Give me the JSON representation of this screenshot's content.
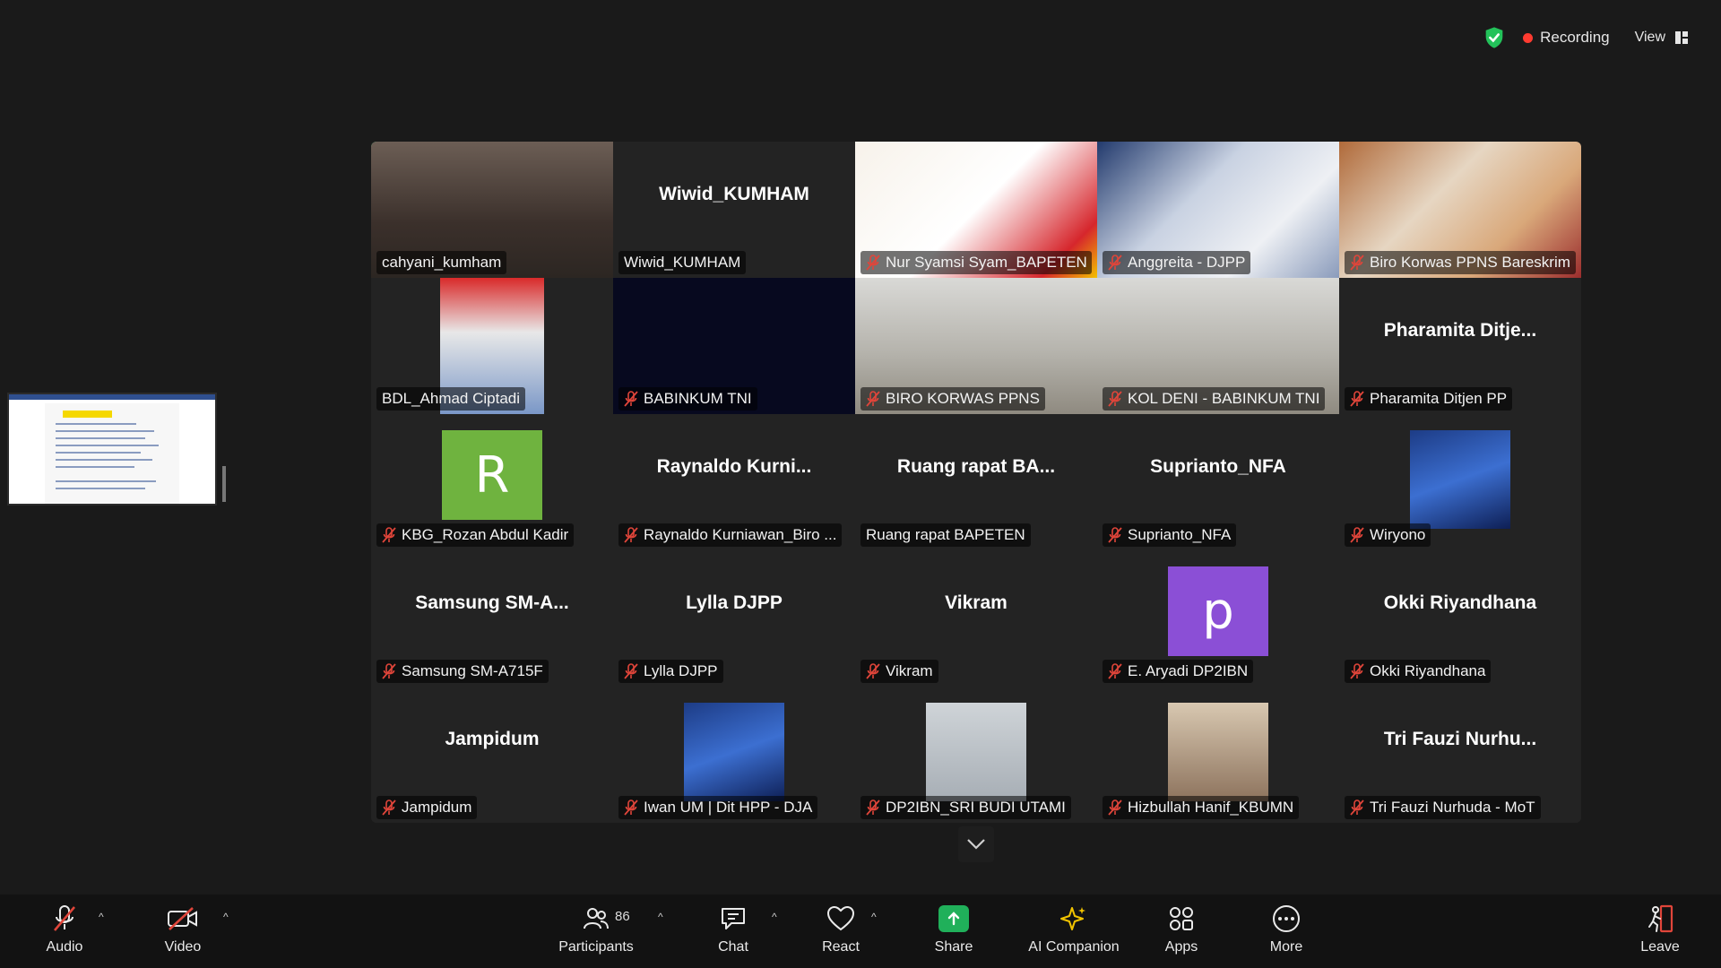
{
  "status": {
    "recording_label": "Recording",
    "view_label": "View"
  },
  "tiles": [
    {
      "name": "cahyani_kumham",
      "center": "",
      "muted": false,
      "kind": "video-face",
      "active": true
    },
    {
      "name": "Wiwid_KUMHAM",
      "center": "Wiwid_KUMHAM",
      "muted": false,
      "kind": "name-only"
    },
    {
      "name": "Nur Syamsi Syam_BAPETEN",
      "center": "",
      "muted": true,
      "kind": "video-banner1"
    },
    {
      "name": "Anggreita - DJPP",
      "center": "",
      "muted": true,
      "kind": "video-banner2"
    },
    {
      "name": "Biro Korwas PPNS Bareskrim",
      "center": "",
      "muted": true,
      "kind": "video-banner3"
    },
    {
      "name": "BDL_Ahmad Ciptadi",
      "center": "",
      "muted": false,
      "kind": "video-small-red"
    },
    {
      "name": "BABINKUM TNI",
      "center": "",
      "muted": true,
      "kind": "video-navy"
    },
    {
      "name": "BIRO KORWAS PPNS",
      "center": "",
      "muted": true,
      "kind": "video-office"
    },
    {
      "name": "KOL DENI - BABINKUM TNI",
      "center": "",
      "muted": true,
      "kind": "video-office"
    },
    {
      "name": "Pharamita Ditjen PP",
      "center": "Pharamita Ditje...",
      "muted": true,
      "kind": "name-only"
    },
    {
      "name": "KBG_Rozan Abdul Kadir",
      "center": "",
      "muted": true,
      "kind": "avatar-green",
      "avatar": "R"
    },
    {
      "name": "Raynaldo Kurniawan_Biro ...",
      "center": "Raynaldo Kurni...",
      "muted": true,
      "kind": "name-only"
    },
    {
      "name": "Ruang rapat BAPETEN",
      "center": "Ruang rapat BA...",
      "muted": false,
      "kind": "name-only"
    },
    {
      "name": "Suprianto_NFA",
      "center": "Suprianto_NFA",
      "muted": true,
      "kind": "name-only"
    },
    {
      "name": "Wiryono",
      "center": "",
      "muted": true,
      "kind": "photo-blue"
    },
    {
      "name": "Samsung SM-A715F",
      "center": "Samsung SM-A...",
      "muted": true,
      "kind": "name-only"
    },
    {
      "name": "Lylla DJPP",
      "center": "Lylla DJPP",
      "muted": true,
      "kind": "name-only"
    },
    {
      "name": "Vikram",
      "center": "Vikram",
      "muted": true,
      "kind": "name-only"
    },
    {
      "name": "E. Aryadi DP2IBN",
      "center": "",
      "muted": true,
      "kind": "avatar-purple",
      "avatar": "p"
    },
    {
      "name": "Okki Riyandhana",
      "center": "Okki Riyandhana",
      "muted": true,
      "kind": "name-only"
    },
    {
      "name": "Jampidum",
      "center": "Jampidum",
      "muted": true,
      "kind": "name-only"
    },
    {
      "name": "Iwan UM | Dit HPP - DJA",
      "center": "",
      "muted": true,
      "kind": "photo-blue"
    },
    {
      "name": "DP2IBN_SRI BUDI UTAMI",
      "center": "",
      "muted": true,
      "kind": "photo-gray"
    },
    {
      "name": "Hizbullah Hanif_KBUMN",
      "center": "",
      "muted": true,
      "kind": "photo-warm"
    },
    {
      "name": "Tri Fauzi Nurhuda - MoT",
      "center": "Tri Fauzi Nurhu...",
      "muted": true,
      "kind": "name-only"
    }
  ],
  "toolbar": {
    "audio": "Audio",
    "video": "Video",
    "participants": "Participants",
    "participants_count": "86",
    "chat": "Chat",
    "react": "React",
    "share": "Share",
    "ai_companion": "AI Companion",
    "apps": "Apps",
    "more": "More",
    "leave": "Leave"
  },
  "colors": {
    "active_speaker": "#2fd180",
    "recording": "#ff3b30",
    "share": "#20b05a",
    "leave": "#e0453a",
    "muted_mic": "#e0453a"
  }
}
